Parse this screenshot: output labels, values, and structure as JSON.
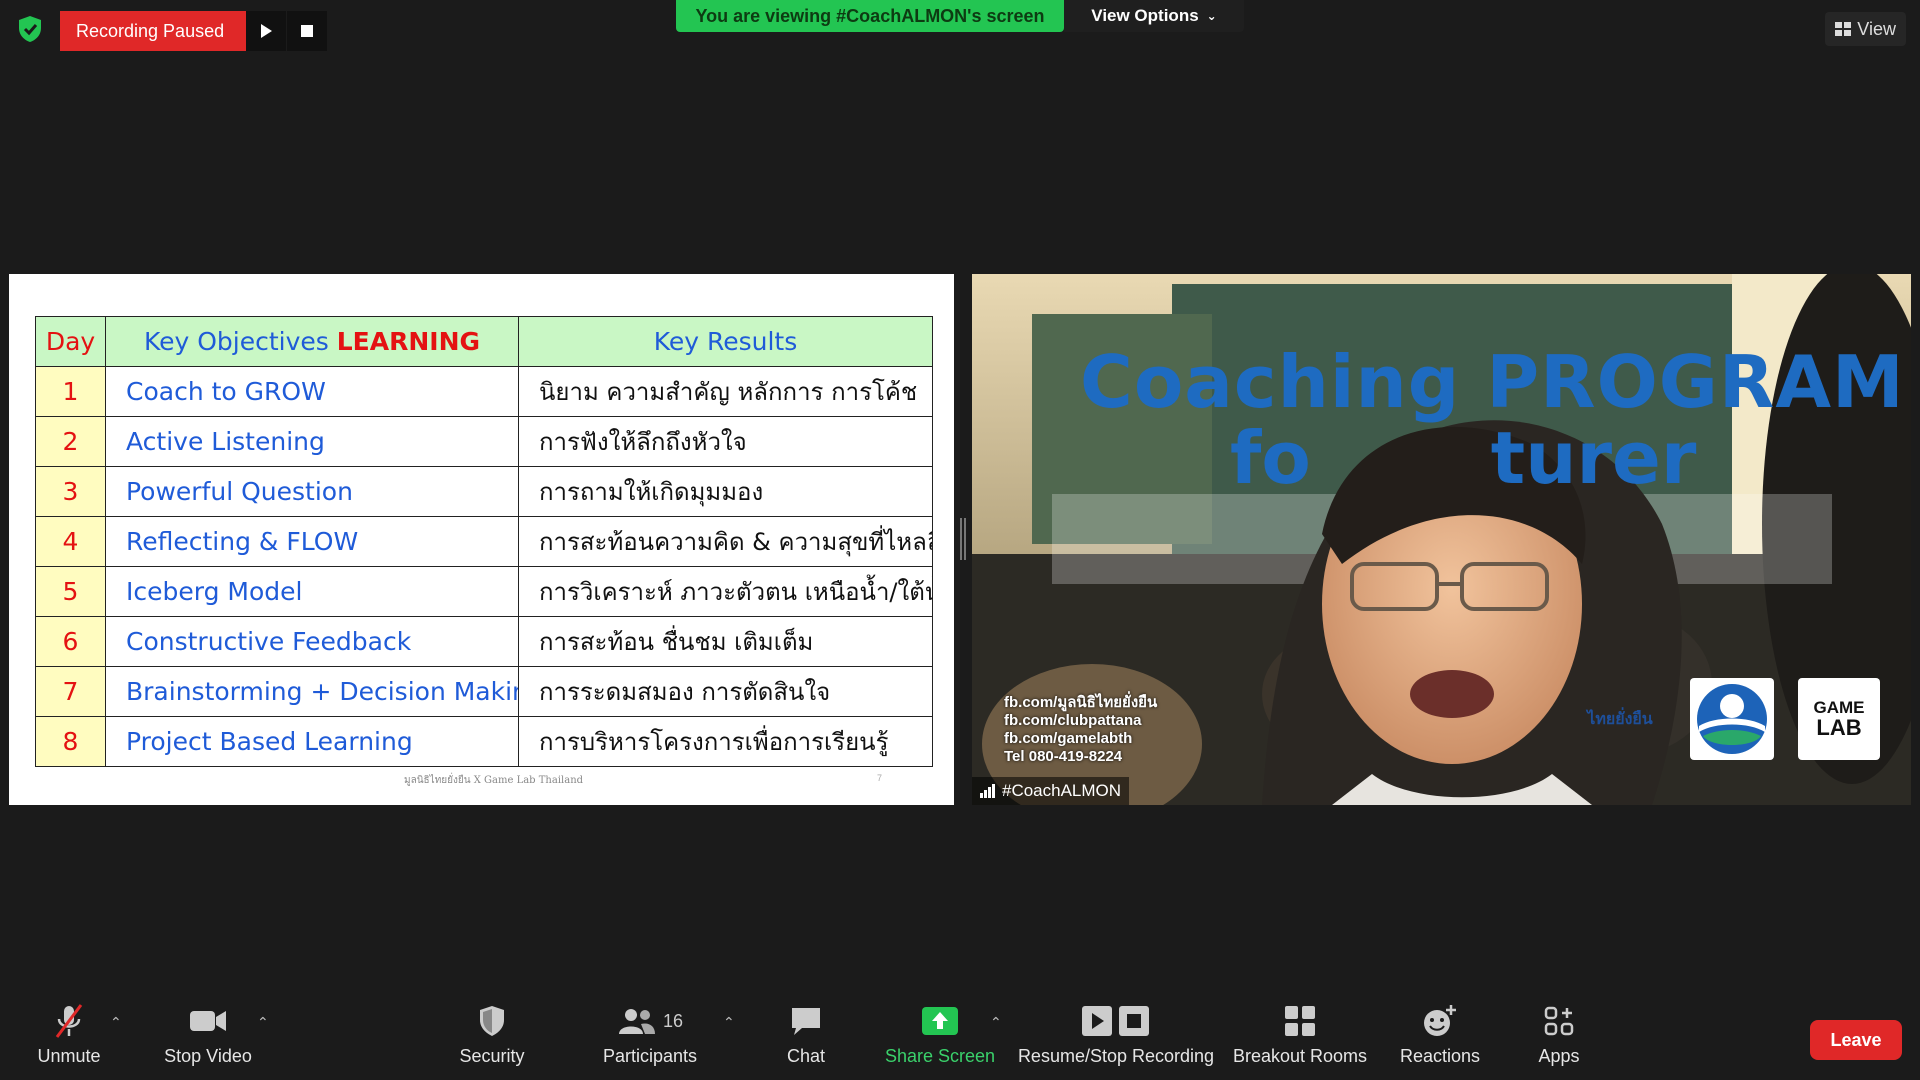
{
  "topbar": {
    "recording_status": "Recording Paused",
    "viewing_banner": "You are viewing #CoachALMON's screen",
    "view_options": "View Options",
    "view_label": "View"
  },
  "slide": {
    "headers": {
      "day": "Day",
      "objectives_prefix": "Key Objectives",
      "objectives_accent": "LEARNING",
      "results": "Key Results"
    },
    "rows": [
      {
        "day": "1",
        "objective": "Coach to GROW",
        "result": "นิยาม ความสำคัญ หลักการ การโค้ช"
      },
      {
        "day": "2",
        "objective": "Active Listening",
        "result": "การฟังให้ลึกถึงหัวใจ"
      },
      {
        "day": "3",
        "objective": "Powerful Question",
        "result": "การถามให้เกิดมุมมอง"
      },
      {
        "day": "4",
        "objective": "Reflecting & FLOW",
        "result": "การสะท้อนความคิด & ความสุขที่ไหลลื่น"
      },
      {
        "day": "5",
        "objective": "Iceberg Model",
        "result": "การวิเคราะห์ ภาวะตัวตน เหนือน้ำ/ใต้น้ำ"
      },
      {
        "day": "6",
        "objective": "Constructive Feedback",
        "result": "การสะท้อน ชื่นชม เติมเต็ม"
      },
      {
        "day": "7",
        "objective": "Brainstorming + Decision Making",
        "result": "การระดมสมอง การตัดสินใจ"
      },
      {
        "day": "8",
        "objective": "Project Based Learning",
        "result": "การบริหารโครงการเพื่อการเรียนรู้"
      }
    ],
    "footer": "มูลนิธิไทยยั่งยืน X Game Lab Thailand",
    "page_number": "7"
  },
  "video": {
    "title": "Coaching PROGRAM",
    "subtitle_left": "fo",
    "subtitle_right": "turer",
    "contact_lines": [
      "fb.com/มูลนิธิไทยยั่งยืน",
      "fb.com/clubpattana",
      "fb.com/gamelabth",
      "Tel 080-419-8224"
    ],
    "logo_thai": "ไทยยั่งยืน",
    "logo_game": "GAME",
    "logo_lab": "LAB",
    "participant_name": "#CoachALMON"
  },
  "toolbar": {
    "unmute": "Unmute",
    "stop_video": "Stop Video",
    "security": "Security",
    "participants": "Participants",
    "participants_count": "16",
    "chat": "Chat",
    "share_screen": "Share Screen",
    "resume_stop_recording": "Resume/Stop Recording",
    "breakout_rooms": "Breakout Rooms",
    "reactions": "Reactions",
    "apps": "Apps",
    "leave": "Leave"
  },
  "colors": {
    "record_red": "#e02828",
    "banner_green": "#23c552",
    "share_green": "#3ad16b",
    "table_header_bg": "#c9f7c5",
    "day_cell_bg": "#fffcc0",
    "objective_blue": "#1f5bd8"
  }
}
